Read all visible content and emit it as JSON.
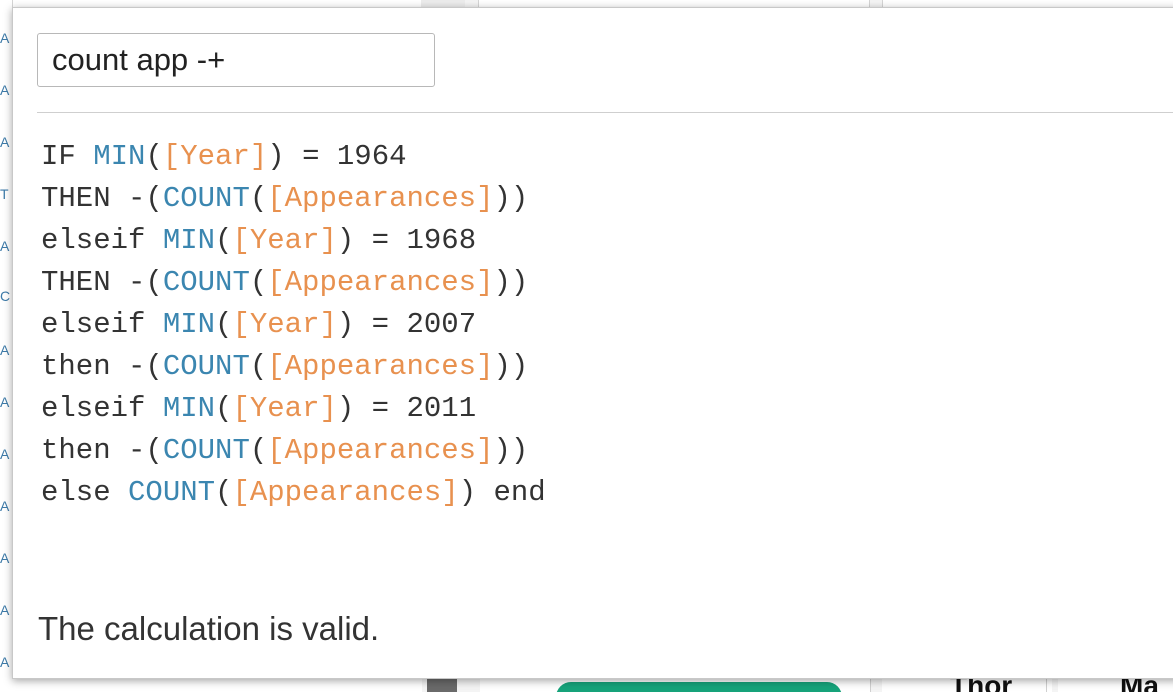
{
  "background": {
    "left_letters": [
      "A",
      "A",
      "A",
      "T",
      "A",
      "C",
      "A",
      "A",
      "A",
      "A",
      "A",
      "A",
      "A"
    ],
    "bottom_texts": [
      "Thor",
      "Ma"
    ]
  },
  "dialog": {
    "calc_name": "count app -+",
    "status_text": "The calculation is valid.",
    "formula_lines": [
      [
        {
          "t": "kw",
          "v": "IF "
        },
        {
          "t": "fn",
          "v": "MIN"
        },
        {
          "t": "op",
          "v": "("
        },
        {
          "t": "field",
          "v": "[Year]"
        },
        {
          "t": "op",
          "v": ") = "
        },
        {
          "t": "num",
          "v": "1964"
        }
      ],
      [
        {
          "t": "kw",
          "v": "THEN "
        },
        {
          "t": "op",
          "v": "-("
        },
        {
          "t": "fn",
          "v": "COUNT"
        },
        {
          "t": "op",
          "v": "("
        },
        {
          "t": "field",
          "v": "[Appearances]"
        },
        {
          "t": "op",
          "v": "))"
        }
      ],
      [
        {
          "t": "kw",
          "v": "elseif "
        },
        {
          "t": "fn",
          "v": "MIN"
        },
        {
          "t": "op",
          "v": "("
        },
        {
          "t": "field",
          "v": "[Year]"
        },
        {
          "t": "op",
          "v": ") = "
        },
        {
          "t": "num",
          "v": "1968"
        }
      ],
      [
        {
          "t": "kw",
          "v": "THEN "
        },
        {
          "t": "op",
          "v": "-("
        },
        {
          "t": "fn",
          "v": "COUNT"
        },
        {
          "t": "op",
          "v": "("
        },
        {
          "t": "field",
          "v": "[Appearances]"
        },
        {
          "t": "op",
          "v": "))"
        }
      ],
      [
        {
          "t": "kw",
          "v": "elseif "
        },
        {
          "t": "fn",
          "v": "MIN"
        },
        {
          "t": "op",
          "v": "("
        },
        {
          "t": "field",
          "v": "[Year]"
        },
        {
          "t": "op",
          "v": ") = "
        },
        {
          "t": "num",
          "v": "2007"
        }
      ],
      [
        {
          "t": "kw",
          "v": "then "
        },
        {
          "t": "op",
          "v": "-("
        },
        {
          "t": "fn",
          "v": "COUNT"
        },
        {
          "t": "op",
          "v": "("
        },
        {
          "t": "field",
          "v": "[Appearances]"
        },
        {
          "t": "op",
          "v": "))"
        }
      ],
      [
        {
          "t": "kw",
          "v": "elseif "
        },
        {
          "t": "fn",
          "v": "MIN"
        },
        {
          "t": "op",
          "v": "("
        },
        {
          "t": "field",
          "v": "[Year]"
        },
        {
          "t": "op",
          "v": ") = "
        },
        {
          "t": "num",
          "v": "2011"
        }
      ],
      [
        {
          "t": "kw",
          "v": "then "
        },
        {
          "t": "op",
          "v": "-("
        },
        {
          "t": "fn",
          "v": "COUNT"
        },
        {
          "t": "op",
          "v": "("
        },
        {
          "t": "field",
          "v": "[Appearances]"
        },
        {
          "t": "op",
          "v": "))"
        }
      ],
      [
        {
          "t": "kw",
          "v": "else "
        },
        {
          "t": "fn",
          "v": "COUNT"
        },
        {
          "t": "op",
          "v": "("
        },
        {
          "t": "field",
          "v": "[Appearances]"
        },
        {
          "t": "op",
          "v": ") "
        },
        {
          "t": "kw",
          "v": "end"
        }
      ]
    ]
  },
  "colors": {
    "function": "#3b86b0",
    "field": "#e8914f",
    "text": "#333333",
    "accent_green": "#16a37a"
  }
}
